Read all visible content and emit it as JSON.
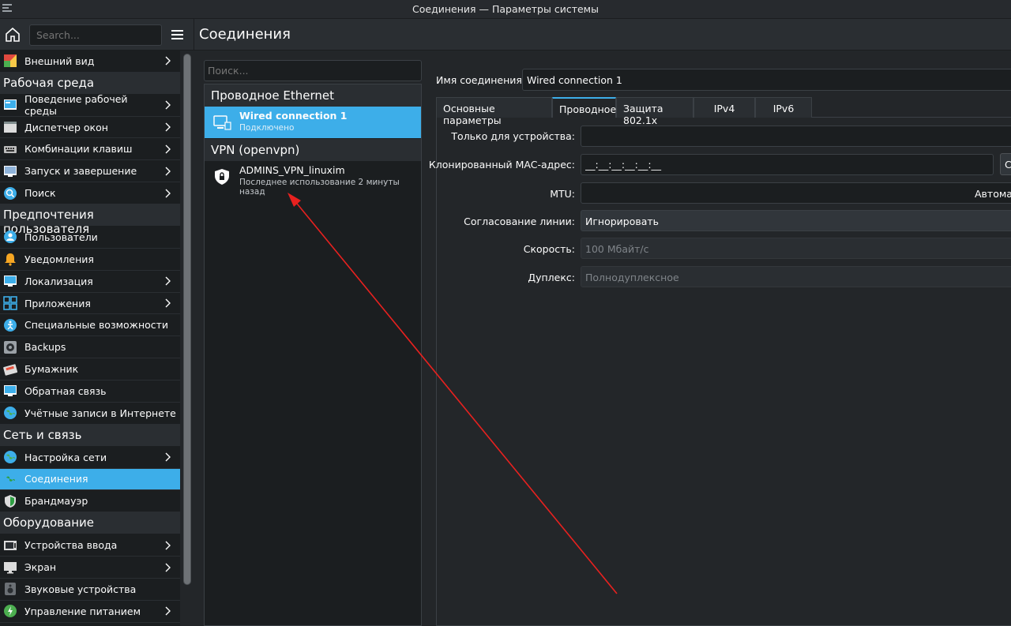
{
  "window": {
    "title": "Соединения — Параметры системы"
  },
  "sidebar": {
    "search_placeholder": "Search...",
    "items": [
      {
        "label": "Внешний вид",
        "icon": "appearance-icon",
        "chevron": true,
        "color": "#e04a3f"
      },
      {
        "category": "Рабочая среда"
      },
      {
        "label": "Поведение рабочей среды",
        "icon": "desktop-behavior-icon",
        "chevron": true,
        "color": "#3daee9"
      },
      {
        "label": "Диспетчер окон",
        "icon": "window-manager-icon",
        "chevron": true,
        "color": "#dcdcdc"
      },
      {
        "label": "Комбинации клавиш",
        "icon": "keyboard-icon",
        "chevron": true,
        "color": "#bdbdbd"
      },
      {
        "label": "Запуск и завершение",
        "icon": "startup-icon",
        "chevron": true,
        "color": "#8fb3d9"
      },
      {
        "label": "Поиск",
        "icon": "search-icon",
        "chevron": true,
        "color": "#3daee9"
      },
      {
        "category": "Предпочтения пользователя"
      },
      {
        "label": "Пользователи",
        "icon": "users-icon",
        "chevron": false,
        "color": "#3daee9"
      },
      {
        "label": "Уведомления",
        "icon": "bell-icon",
        "chevron": false,
        "color": "#f5a623"
      },
      {
        "label": "Локализация",
        "icon": "locale-icon",
        "chevron": true,
        "color": "#3daee9"
      },
      {
        "label": "Приложения",
        "icon": "applications-icon",
        "chevron": true,
        "color": "#3daee9"
      },
      {
        "label": "Специальные возможности",
        "icon": "accessibility-icon",
        "chevron": false,
        "color": "#3daee9"
      },
      {
        "label": "Backups",
        "icon": "backup-icon",
        "chevron": false,
        "color": "#9aa0a6"
      },
      {
        "label": "Бумажник",
        "icon": "wallet-icon",
        "chevron": false,
        "color": "#e8543f"
      },
      {
        "label": "Обратная связь",
        "icon": "feedback-icon",
        "chevron": false,
        "color": "#3daee9"
      },
      {
        "label": "Учётные записи в Интернете",
        "icon": "online-accounts-icon",
        "chevron": false,
        "color": "#3daee9"
      },
      {
        "category": "Сеть и связь"
      },
      {
        "label": "Настройка сети",
        "icon": "network-settings-icon",
        "chevron": true,
        "color": "#3daee9"
      },
      {
        "label": "Соединения",
        "icon": "connections-icon",
        "chevron": false,
        "selected": true,
        "color": "#2ea043"
      },
      {
        "label": "Брандмауэр",
        "icon": "firewall-icon",
        "chevron": false,
        "color": "#2ea043"
      },
      {
        "category": "Оборудование"
      },
      {
        "label": "Устройства ввода",
        "icon": "input-devices-icon",
        "chevron": true,
        "color": "#dcdcdc"
      },
      {
        "label": "Экран",
        "icon": "display-icon",
        "chevron": true,
        "color": "#dcdcdc"
      },
      {
        "label": "Звуковые устройства",
        "icon": "audio-icon",
        "chevron": false,
        "color": "#6b7075"
      },
      {
        "label": "Управление питанием",
        "icon": "power-icon",
        "chevron": true,
        "color": "#4caf50"
      }
    ]
  },
  "header": {
    "title": "Соединения"
  },
  "connections": {
    "search_placeholder": "Поиск...",
    "groups": [
      {
        "name": "Проводное Ethernet",
        "items": [
          {
            "name": "Wired connection 1",
            "status": "Подключено",
            "selected": true,
            "icon": "wired-network-icon"
          }
        ]
      },
      {
        "name": "VPN (openvpn)",
        "items": [
          {
            "name": "ADMINS_VPN_linuxim",
            "status": "Последнее использование 2 минуты назад",
            "selected": false,
            "icon": "vpn-shield-icon"
          }
        ]
      }
    ]
  },
  "details": {
    "name_label": "Имя соединения:",
    "name_value": "Wired connection 1",
    "tabs": [
      "Основные параметры",
      "Проводное",
      "Защита 802.1x",
      "IPv4",
      "IPv6"
    ],
    "active_tab": 1,
    "fields": {
      "device_label": "Только для устройства:",
      "device_value": "",
      "mac_label": "Клонированный MAC-адрес:",
      "mac_value": "__:__:__:__:__:__",
      "mac_button": "С",
      "mtu_label": "MTU:",
      "mtu_value": "Автомат",
      "negotiation_label": "Согласование линии:",
      "negotiation_value": "Игнорировать",
      "speed_label": "Скорость:",
      "speed_value": "100 Мбайт/с",
      "duplex_label": "Дуплекс:",
      "duplex_value": "Полнодуплексное"
    }
  },
  "annotation": {
    "arrow_color": "#e8211f"
  }
}
